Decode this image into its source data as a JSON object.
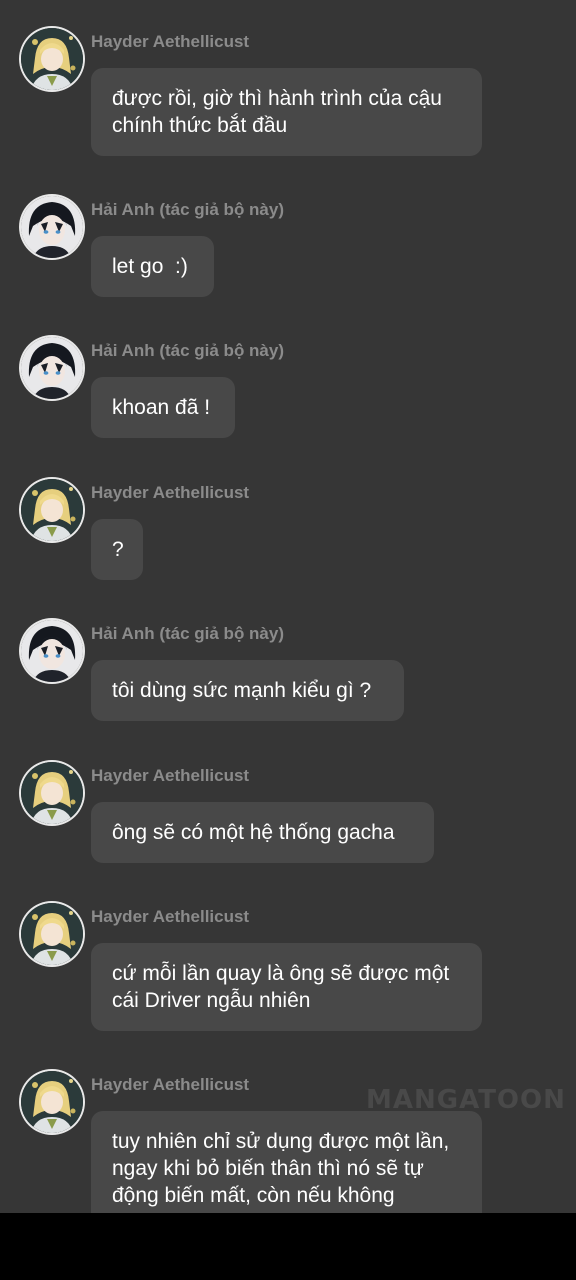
{
  "colors": {
    "background": "#363636",
    "bubble": "#484848",
    "name_text": "#8b8b8b",
    "message_text": "#ffffff"
  },
  "watermark": "MANGATOON",
  "messages": [
    {
      "sender": "Hayder Aethellicust",
      "avatar": "blonde-character-avatar-icon",
      "text": "được rồi, giờ thì hành trình của cậu chính thức bắt đầu"
    },
    {
      "sender": "Hải Anh (tác giả bộ này)",
      "avatar": "dark-hair-character-avatar-icon",
      "text": "let go  :)"
    },
    {
      "sender": "Hải Anh (tác giả bộ này)",
      "avatar": "dark-hair-character-avatar-icon",
      "text": "khoan đã !"
    },
    {
      "sender": "Hayder Aethellicust",
      "avatar": "blonde-character-avatar-icon",
      "text": "?"
    },
    {
      "sender": "Hải Anh (tác giả bộ này)",
      "avatar": "dark-hair-character-avatar-icon",
      "text": "tôi dùng sức mạnh kiểu gì ?"
    },
    {
      "sender": "Hayder Aethellicust",
      "avatar": "blonde-character-avatar-icon",
      "text": "ông sẽ có một hệ thống gacha"
    },
    {
      "sender": "Hayder Aethellicust",
      "avatar": "blonde-character-avatar-icon",
      "text": "cứ mỗi lần quay là ông sẽ được một cái Driver ngẫu nhiên"
    },
    {
      "sender": "Hayder Aethellicust",
      "avatar": "blonde-character-avatar-icon",
      "text": "tuy nhiên chỉ sử dụng được một lần, ngay khi bỏ biến thân thì nó sẽ tự động biến mất, còn nếu không"
    }
  ]
}
